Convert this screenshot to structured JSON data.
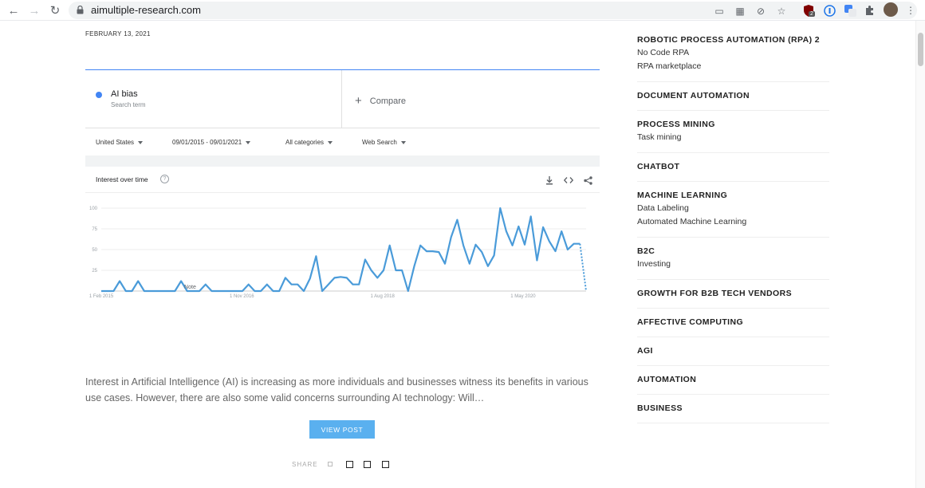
{
  "browser": {
    "url": "aimultiple-research.com",
    "extension_badge": "2"
  },
  "post": {
    "date": "FEBRUARY 13, 2021",
    "excerpt": "Interest in Artificial Intelligence (AI) is increasing as more individuals and businesses witness its benefits in various use cases. However, there are also some valid concerns surrounding AI technology: Will…",
    "view_post_label": "VIEW POST",
    "share_label": "SHARE"
  },
  "trends": {
    "term_name": "AI bias",
    "term_sub": "Search term",
    "compare_label": "Compare",
    "filters": {
      "region": "United States",
      "date_range": "09/01/2015 - 09/01/2021",
      "category": "All categories",
      "search_type": "Web Search"
    },
    "section_title": "Interest over time",
    "colors": {
      "accent": "#4285f4",
      "series": "#4a9bd9"
    }
  },
  "chart_data": {
    "type": "line",
    "ylim": [
      0,
      100
    ],
    "yticks": [
      "100",
      "75",
      "50",
      "25"
    ],
    "xticks": [
      {
        "label": "1 Feb 2015",
        "t": 0.0
      },
      {
        "label": "1 Nov 2016",
        "t": 0.29
      },
      {
        "label": "1 Aug 2018",
        "t": 0.58
      },
      {
        "label": "1 May 2020",
        "t": 0.87
      }
    ],
    "annotation": "Note",
    "values": [
      0,
      0,
      0,
      12,
      0,
      0,
      12,
      0,
      0,
      0,
      0,
      0,
      0,
      12,
      0,
      0,
      0,
      8,
      0,
      0,
      0,
      0,
      0,
      0,
      8,
      0,
      0,
      8,
      0,
      0,
      16,
      8,
      8,
      0,
      15,
      42,
      0,
      8,
      16,
      17,
      16,
      8,
      8,
      38,
      25,
      16,
      25,
      55,
      25,
      25,
      0,
      30,
      55,
      48,
      48,
      47,
      33,
      65,
      86,
      55,
      33,
      56,
      47,
      30,
      43,
      100,
      72,
      55,
      78,
      56,
      90,
      37,
      77,
      60,
      48,
      72,
      50,
      57,
      57,
      0
    ],
    "partial_last_segment": true
  },
  "sidebar": {
    "categories": [
      {
        "title": "ROBOTIC PROCESS AUTOMATION (RPA) 2",
        "subs": [
          "No Code RPA",
          "RPA marketplace"
        ]
      },
      {
        "title": "DOCUMENT AUTOMATION",
        "subs": []
      },
      {
        "title": "PROCESS MINING",
        "subs": [
          "Task mining"
        ]
      },
      {
        "title": "CHATBOT",
        "subs": []
      },
      {
        "title": "MACHINE LEARNING",
        "subs": [
          "Data Labeling",
          "Automated Machine Learning"
        ]
      },
      {
        "title": "B2C",
        "subs": [
          "Investing"
        ]
      },
      {
        "title": "GROWTH FOR B2B TECH VENDORS",
        "subs": []
      },
      {
        "title": "AFFECTIVE COMPUTING",
        "subs": []
      },
      {
        "title": "AGI",
        "subs": []
      },
      {
        "title": "AUTOMATION",
        "subs": []
      },
      {
        "title": "BUSINESS",
        "subs": []
      }
    ]
  }
}
